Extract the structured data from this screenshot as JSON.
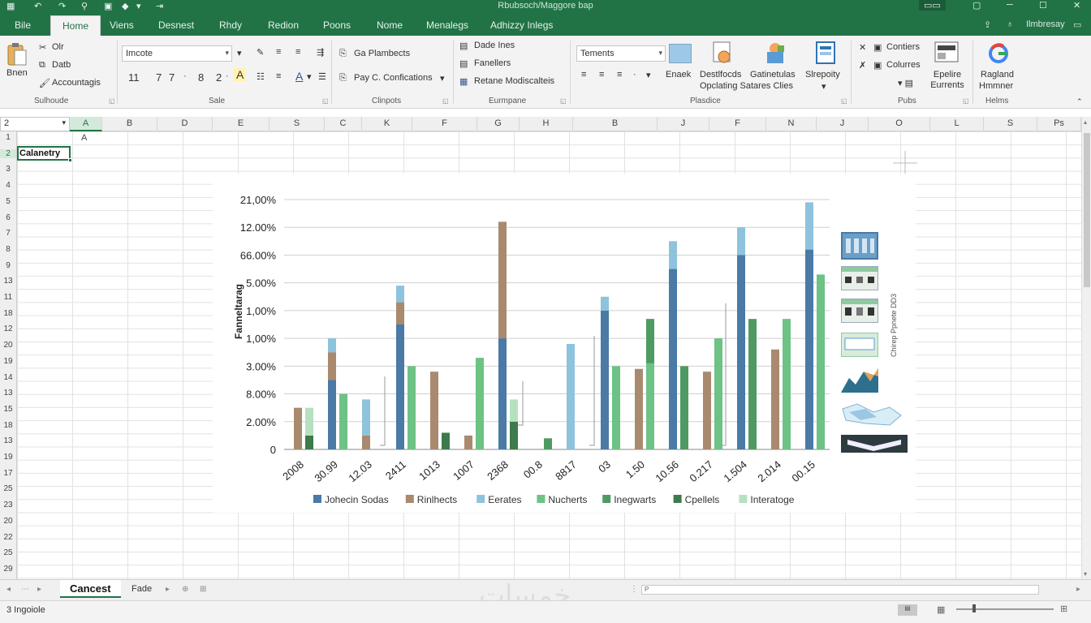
{
  "titlebar": {
    "title": "Rbubsoch/Maggore bap",
    "qa_items": [
      "▦",
      "↶",
      "↷",
      "⚲",
      "◆",
      "▾",
      "⇥"
    ]
  },
  "tabs": {
    "file": "Bile",
    "items": [
      "Home",
      "Viens",
      "Desnest",
      "Rhdy",
      "Redion",
      "Poons",
      "Nome",
      "Menalegs",
      "Adhizzy Inlegs"
    ],
    "active_index": 0,
    "right": [
      "Ilmbresay",
      "▭"
    ]
  },
  "ribbon": {
    "clipboard": {
      "big_label": "Bnen",
      "items": [
        "Olr",
        "Datb",
        "Accountagis"
      ],
      "group_label": "Sulhoude"
    },
    "font": {
      "font_name": "Imcote",
      "font_size": "11",
      "row2": [
        "11",
        "7",
        "7",
        "·",
        "8",
        "2",
        "·",
        "A"
      ],
      "group_label": "Sale"
    },
    "clipboard2": {
      "items": [
        "Ga Plambects",
        "Pay C. Confications"
      ],
      "group_label": "Clinpots"
    },
    "enterprise": {
      "items": [
        "Dade Ines",
        "Fanellers",
        "Retane Modiscalteis"
      ],
      "group_label": "Eurmpane"
    },
    "number": {
      "format": "Tements",
      "buttons": [
        "Enaek",
        "Destlfocds",
        "Gatinetulas",
        "Slrepoity"
      ],
      "sub": "Opclating Satares Clies",
      "group_label": "Plasdice"
    },
    "cells": {
      "items": [
        "Contiers",
        "Colurres",
        "Epelire Eurrents"
      ],
      "group_label": "Pubs"
    },
    "help": {
      "items": [
        "Ragland",
        "Hmmner"
      ],
      "group_label": "Helms"
    }
  },
  "namebox": "2",
  "columns": [
    "A",
    "A",
    "B",
    "D",
    "E",
    "S",
    "C",
    "K",
    "F",
    "G",
    "H",
    "B",
    "J",
    "F",
    "N",
    "J",
    "O",
    "L",
    "S",
    "Ps"
  ],
  "rows": [
    "1",
    "2",
    "3",
    "4",
    "5",
    "6",
    "7",
    "8",
    "9",
    "13",
    "11",
    "18",
    "12",
    "20",
    "19",
    "14",
    "13",
    "15",
    "18",
    "13",
    "19",
    "17",
    "25",
    "23",
    "20",
    "22",
    "25",
    "29"
  ],
  "cells": {
    "A1": "A",
    "A2": "Calanetry"
  },
  "chart_data": {
    "type": "bar",
    "title": "",
    "ylabel": "Fanneltarag",
    "ytick_labels": [
      "0",
      "2.00%",
      "8.00%",
      "3.00%",
      "1,00%",
      "1,00%",
      "5.00%",
      "66.00%",
      "12.00%",
      "21,00%"
    ],
    "categories": [
      "2008",
      "30.99",
      "12.03",
      "2411",
      "1013",
      "1007",
      "2368",
      "00.8",
      "8817",
      "03",
      "1.50",
      "10.56",
      "0.217",
      "1.504",
      "2.014",
      "00.15"
    ],
    "series": [
      {
        "name": "Johecin Sodas",
        "color": "#4a7aa5",
        "values": [
          0,
          2.5,
          0,
          4.5,
          0,
          0,
          4.0,
          0,
          0,
          5.0,
          0,
          6.5,
          0,
          7.0,
          0,
          7.2
        ]
      },
      {
        "name": "Rinlhects",
        "color": "#a98a6e",
        "values": [
          1.5,
          1.0,
          0.5,
          0.8,
          2.8,
          0.5,
          4.2,
          0,
          0,
          0,
          2.9,
          0,
          2.8,
          0,
          3.6,
          0
        ]
      },
      {
        "name": "Eerates",
        "color": "#8ec3dd",
        "values": [
          0,
          0.5,
          1.3,
          0.6,
          0,
          0,
          0,
          0,
          3.8,
          0.5,
          0,
          1.0,
          0,
          1.0,
          0,
          1.7
        ]
      },
      {
        "name": "Nucherts",
        "color": "#6dc285",
        "values": [
          0,
          2.0,
          0,
          3.0,
          0,
          3.3,
          0,
          0,
          0,
          3.0,
          3.1,
          0,
          4.0,
          0,
          4.7,
          6.3
        ]
      },
      {
        "name": "Inegwarts",
        "color": "#4f9a63",
        "values": [
          0,
          0,
          0,
          0,
          0,
          0,
          0,
          0.4,
          0,
          0,
          1.6,
          3.0,
          0,
          4.7,
          0,
          0
        ]
      },
      {
        "name": "Cpellels",
        "color": "#3d7a4c",
        "values": [
          0.5,
          0,
          0,
          0,
          0.6,
          0,
          1.0,
          0,
          0,
          0,
          0,
          0,
          0,
          0,
          0,
          0
        ]
      },
      {
        "name": "Interatoge",
        "color": "#b7e0bf",
        "values": [
          1.0,
          0,
          0,
          0,
          0,
          0,
          0.8,
          0,
          0,
          0,
          0,
          0,
          0,
          0,
          0,
          0
        ]
      }
    ],
    "ylim": [
      0,
      9.0
    ],
    "grid": true,
    "legend": "bottom"
  },
  "side_panel_text": "Chirep Ppnete DD3",
  "sheet_tabs": [
    "Cancest",
    "Fade"
  ],
  "status_text": "3 Ingoiole",
  "watermark": "خمسات",
  "scroll_hint": "P"
}
